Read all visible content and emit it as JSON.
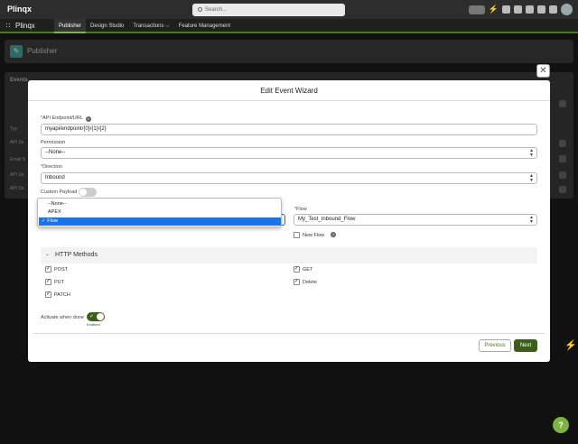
{
  "header": {
    "logo": "Plinqx",
    "search_placeholder": "Search..."
  },
  "nav": {
    "app_name": "Plinqx",
    "tabs": [
      {
        "label": "Publisher"
      },
      {
        "label": "Design Studio"
      },
      {
        "label": "Transactions ⌵"
      },
      {
        "label": "Feature Management"
      }
    ]
  },
  "page": {
    "title": "Publisher",
    "card_title": "Events",
    "rows": [
      "API Se",
      "Email S",
      "API Se",
      "API Se"
    ],
    "type_header": "Typ"
  },
  "modal": {
    "title": "Edit Event Wizard",
    "api_endpoint": {
      "label": "API Endpoint/URL",
      "value": "myapi/endpoint/{0}/{1}/{2}"
    },
    "permission": {
      "label": "Permission",
      "value": "--None--"
    },
    "direction": {
      "label": "Direction",
      "value": "Inbound"
    },
    "custom_payload": {
      "label": "Custom Payload"
    },
    "type_dropdown": {
      "options": [
        "--None--",
        "APEX",
        "Flow"
      ],
      "selected": "Flow"
    },
    "flow": {
      "label": "Flow",
      "value": "My_Test_Inbound_Flow"
    },
    "new_flow": {
      "label": "New Flow"
    },
    "http_methods": {
      "title": "HTTP Methods",
      "methods": [
        {
          "label": "POST",
          "checked": true
        },
        {
          "label": "GET",
          "checked": true
        },
        {
          "label": "PUT",
          "checked": true
        },
        {
          "label": "Delete",
          "checked": true
        },
        {
          "label": "PATCH",
          "checked": true
        }
      ]
    },
    "activate": {
      "label": "Activate when done",
      "state": "Enabled"
    },
    "buttons": {
      "previous": "Previous",
      "next": "Next"
    }
  },
  "colors": {
    "brand": "#3b5f1b",
    "accent": "#7cb342",
    "selection": "#1a73e8"
  }
}
